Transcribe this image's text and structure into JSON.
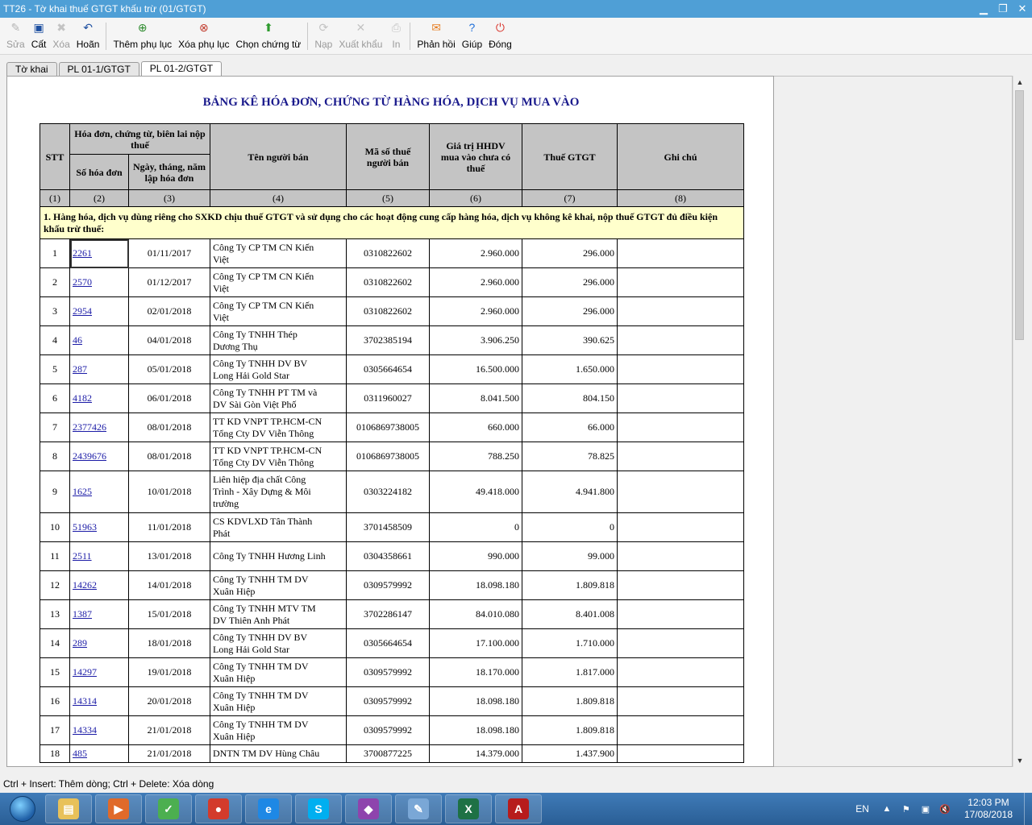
{
  "window": {
    "title": "TT26 - Tờ khai thuế GTGT khấu trừ (01/GTGT)"
  },
  "toolbar": {
    "buttons": [
      {
        "label": "Sửa",
        "icon": "edit-icon",
        "enabled": false
      },
      {
        "label": "Cất",
        "icon": "save-icon",
        "enabled": true
      },
      {
        "label": "Xóa",
        "icon": "delete-icon",
        "enabled": false
      },
      {
        "label": "Hoãn",
        "icon": "undo-icon",
        "enabled": true
      },
      {
        "label": "Thêm phụ lục",
        "icon": "add-appendix-icon",
        "enabled": true
      },
      {
        "label": "Xóa phụ lục",
        "icon": "delete-appendix-icon",
        "enabled": true
      },
      {
        "label": "Chọn chứng từ",
        "icon": "green-arrow-up-icon",
        "enabled": true
      },
      {
        "label": "Nạp",
        "icon": "load-icon",
        "enabled": false
      },
      {
        "label": "Xuất khẩu",
        "icon": "export-icon",
        "enabled": false
      },
      {
        "label": "In",
        "icon": "print-icon",
        "enabled": false
      },
      {
        "label": "Phản hồi",
        "icon": "feedback-mail-icon",
        "enabled": true
      },
      {
        "label": "Giúp",
        "icon": "help-icon",
        "enabled": true
      },
      {
        "label": "Đóng",
        "icon": "power-icon",
        "enabled": true
      }
    ]
  },
  "tabs": [
    "Tờ khai",
    "PL 01-1/GTGT",
    "PL 01-2/GTGT"
  ],
  "document": {
    "title": "BẢNG KÊ HÓA ĐƠN, CHỨNG TỪ HÀNG HÓA, DỊCH VỤ MUA VÀO",
    "headers": {
      "stt": "STT",
      "invoice_group": "Hóa đơn, chứng từ, biên lai nộp thuế",
      "invoice_no": "Số hóa đơn",
      "invoice_date_l1": "Ngày, tháng, năm",
      "invoice_date_l2": "lập hóa đơn",
      "seller": "Tên người bán",
      "tax_code_l1": "Mã số thuế",
      "tax_code_l2": "người bán",
      "value_l1": "Giá trị HHDV",
      "value_l2": "mua vào chưa có",
      "value_l3": "thuế",
      "vat": "Thuế GTGT",
      "note": "Ghi chú"
    },
    "column_numbers": [
      "(1)",
      "(2)",
      "(3)",
      "(4)",
      "(5)",
      "(6)",
      "(7)",
      "(8)"
    ],
    "section_title": "1. Hàng hóa, dịch vụ dùng riêng cho SXKD chịu thuế GTGT và sử dụng cho các hoạt động cung cấp hàng hóa, dịch vụ không kê khai, nộp thuế GTGT đủ điều kiện khấu trừ thuế:",
    "rows": [
      {
        "stt": "1",
        "invoice": "2261",
        "date": "01/11/2017",
        "seller_l1": "Công Ty CP TM CN Kiến",
        "seller_l2": "Việt",
        "tax_code": "0310822602",
        "value": "2.960.000",
        "vat": "296.000"
      },
      {
        "stt": "2",
        "invoice": "2570",
        "date": "01/12/2017",
        "seller_l1": "Công Ty CP TM CN Kiến",
        "seller_l2": "Việt",
        "tax_code": "0310822602",
        "value": "2.960.000",
        "vat": "296.000"
      },
      {
        "stt": "3",
        "invoice": "2954",
        "date": "02/01/2018",
        "seller_l1": "Công Ty CP TM CN Kiến",
        "seller_l2": "Việt",
        "tax_code": "0310822602",
        "value": "2.960.000",
        "vat": "296.000"
      },
      {
        "stt": "4",
        "invoice": "46",
        "date": "04/01/2018",
        "seller_l1": "Công Ty TNHH Thép",
        "seller_l2": "Dương Thụ",
        "tax_code": "3702385194",
        "value": "3.906.250",
        "vat": "390.625"
      },
      {
        "stt": "5",
        "invoice": "287",
        "date": "05/01/2018",
        "seller_l1": "Công Ty TNHH DV BV",
        "seller_l2": "Long Hải Gold Star",
        "tax_code": "0305664654",
        "value": "16.500.000",
        "vat": "1.650.000"
      },
      {
        "stt": "6",
        "invoice": "4182",
        "date": "06/01/2018",
        "seller_l1": "Công Ty TNHH PT TM và",
        "seller_l2": "DV Sài Gòn Việt Phố",
        "tax_code": "0311960027",
        "value": "8.041.500",
        "vat": "804.150"
      },
      {
        "stt": "7",
        "invoice": "2377426",
        "date": "08/01/2018",
        "seller_l1": "TT KD VNPT TP.HCM-CN",
        "seller_l2": "Tổng Cty DV Viễn Thông",
        "tax_code": "0106869738005",
        "value": "660.000",
        "vat": "66.000"
      },
      {
        "stt": "8",
        "invoice": "2439676",
        "date": "08/01/2018",
        "seller_l1": "TT KD VNPT TP.HCM-CN",
        "seller_l2": "Tổng Cty DV Viễn Thông",
        "tax_code": "0106869738005",
        "value": "788.250",
        "vat": "78.825"
      },
      {
        "stt": "9",
        "invoice": "1625",
        "date": "10/01/2018",
        "seller_l1": "Liên hiệp địa chất Công",
        "seller_l2": "Trình - Xây Dựng & Môi",
        "seller_l3": "trường",
        "tax_code": "0303224182",
        "value": "49.418.000",
        "vat": "4.941.800"
      },
      {
        "stt": "10",
        "invoice": "51963",
        "date": "11/01/2018",
        "seller_l1": "CS KDVLXD Tân Thành",
        "seller_l2": "Phát",
        "tax_code": "3701458509",
        "value": "0",
        "vat": "0"
      },
      {
        "stt": "11",
        "invoice": "2511",
        "date": "13/01/2018",
        "seller_l1": "Công Ty TNHH Hương Linh",
        "seller_l2": "",
        "tax_code": "0304358661",
        "value": "990.000",
        "vat": "99.000"
      },
      {
        "stt": "12",
        "invoice": "14262",
        "date": "14/01/2018",
        "seller_l1": "Công Ty TNHH TM DV",
        "seller_l2": "Xuân Hiệp",
        "tax_code": "0309579992",
        "value": "18.098.180",
        "vat": "1.809.818"
      },
      {
        "stt": "13",
        "invoice": "1387",
        "date": "15/01/2018",
        "seller_l1": "Công Ty TNHH MTV TM",
        "seller_l2": "DV Thiên Anh Phát",
        "tax_code": "3702286147",
        "value": "84.010.080",
        "vat": "8.401.008"
      },
      {
        "stt": "14",
        "invoice": "289",
        "date": "18/01/2018",
        "seller_l1": "Công Ty TNHH DV BV",
        "seller_l2": "Long Hải Gold Star",
        "tax_code": "0305664654",
        "value": "17.100.000",
        "vat": "1.710.000"
      },
      {
        "stt": "15",
        "invoice": "14297",
        "date": "19/01/2018",
        "seller_l1": "Công Ty TNHH TM DV",
        "seller_l2": "Xuân Hiệp",
        "tax_code": "0309579992",
        "value": "18.170.000",
        "vat": "1.817.000"
      },
      {
        "stt": "16",
        "invoice": "14314",
        "date": "20/01/2018",
        "seller_l1": "Công Ty TNHH TM DV",
        "seller_l2": "Xuân Hiệp",
        "tax_code": "0309579992",
        "value": "18.098.180",
        "vat": "1.809.818"
      },
      {
        "stt": "17",
        "invoice": "14334",
        "date": "21/01/2018",
        "seller_l1": "Công Ty TNHH TM DV",
        "seller_l2": "Xuân Hiệp",
        "tax_code": "0309579992",
        "value": "18.098.180",
        "vat": "1.809.818"
      },
      {
        "stt": "18",
        "invoice": "485",
        "date": "21/01/2018",
        "seller_l1": "DNTN TM DV Hùng Châu",
        "seller_l2": "",
        "tax_code": "3700877225",
        "value": "14.379.000",
        "vat": "1.437.900"
      }
    ]
  },
  "statusbar": {
    "text": "Ctrl + Insert: Thêm dòng; Ctrl + Delete: Xóa dòng"
  },
  "taskbar": {
    "apps": [
      {
        "icon": "file-explorer-icon",
        "color": "#e8c15a",
        "glyph": "▤"
      },
      {
        "icon": "media-player-icon",
        "color": "#e06a2a",
        "glyph": "▶"
      },
      {
        "icon": "green-app-icon",
        "color": "#4caf50",
        "glyph": "✓"
      },
      {
        "icon": "chrome-icon",
        "color": "#d33b2c",
        "glyph": "●"
      },
      {
        "icon": "internet-explorer-icon",
        "color": "#1e88e5",
        "glyph": "e"
      },
      {
        "icon": "skype-icon",
        "color": "#00aff0",
        "glyph": "S"
      },
      {
        "icon": "picasa-icon",
        "color": "#8e44ad",
        "glyph": "◆"
      },
      {
        "icon": "notepad-icon",
        "color": "#7aa7d6",
        "glyph": "✎"
      },
      {
        "icon": "excel-icon",
        "color": "#1e7145",
        "glyph": "X"
      },
      {
        "icon": "pdf-reader-icon",
        "color": "#b71c1c",
        "glyph": "A"
      }
    ],
    "language": "EN",
    "time": "12:03 PM",
    "date": "17/08/2018"
  }
}
